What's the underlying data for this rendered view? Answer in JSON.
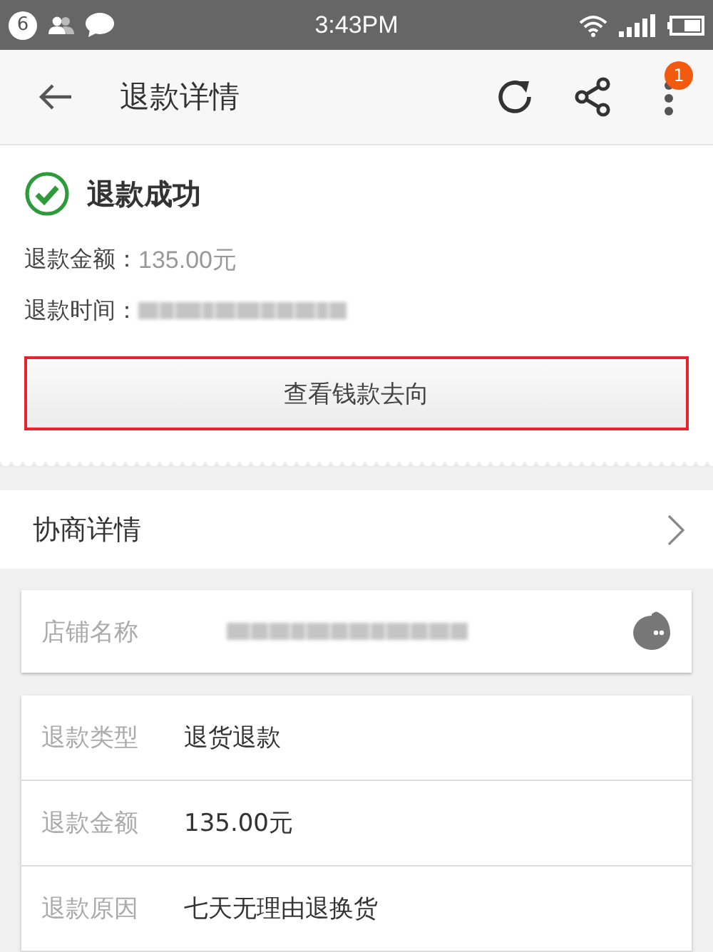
{
  "status_bar": {
    "notification_count": "6",
    "time": "3:43PM"
  },
  "header": {
    "title": "退款详情",
    "badge": "1"
  },
  "status": {
    "title": "退款成功",
    "lines": [
      {
        "label": "退款金额：",
        "value": "135.00元"
      },
      {
        "label": "退款时间：",
        "redacted": true
      }
    ],
    "button": "查看钱款去向"
  },
  "negotiation": {
    "label": "协商详情"
  },
  "shop": {
    "label": "店铺名称",
    "redacted": true
  },
  "details": [
    {
      "label": "退款类型",
      "value": "退货退款"
    },
    {
      "label": "退款金额",
      "value": "135.00元"
    },
    {
      "label": "退款原因",
      "value": "七天无理由退换货"
    }
  ]
}
